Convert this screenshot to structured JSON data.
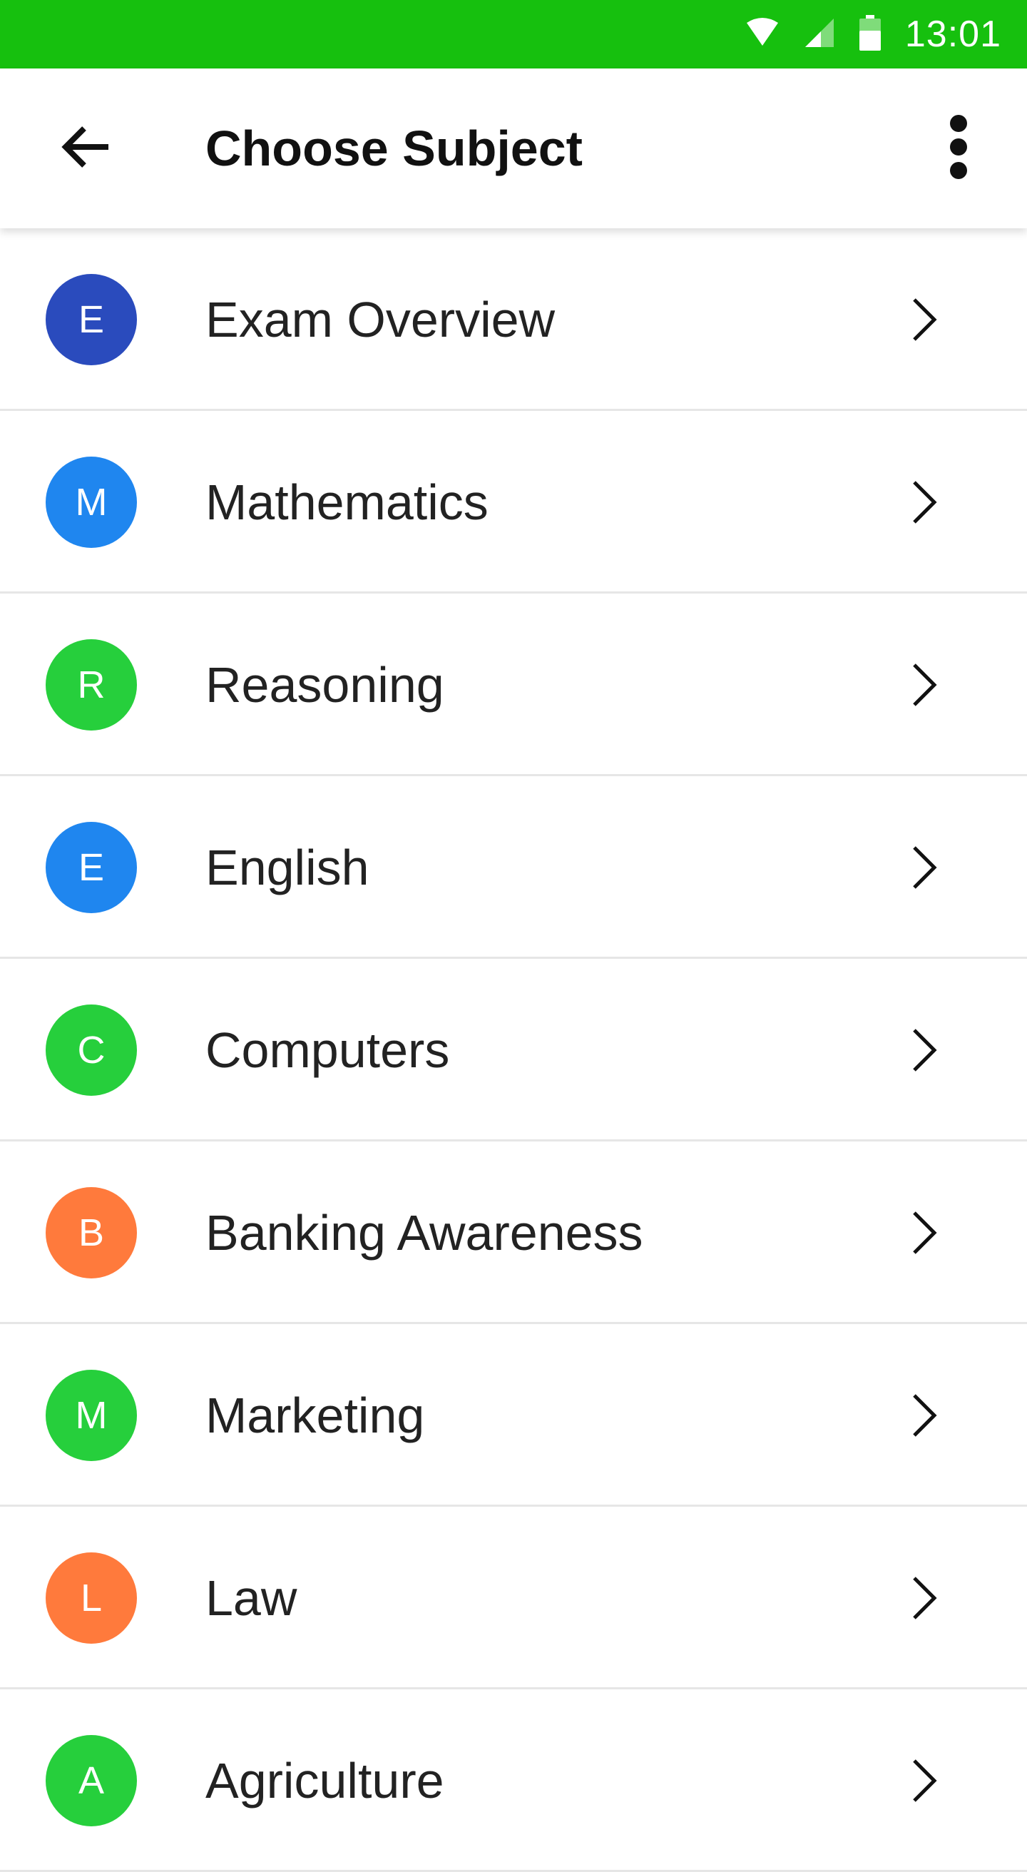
{
  "status_bar": {
    "time": "13:01",
    "icons": [
      "wifi-icon",
      "cell-signal-icon",
      "battery-icon"
    ],
    "background_color": "#16c00e"
  },
  "app_bar": {
    "title": "Choose Subject",
    "back_icon": "arrow-back-icon",
    "menu_icon": "more-vertical-icon"
  },
  "subjects": [
    {
      "initial": "E",
      "label": "Exam Overview",
      "color": "#2a4bbd"
    },
    {
      "initial": "M",
      "label": "Mathematics",
      "color": "#1f86ef"
    },
    {
      "initial": "R",
      "label": "Reasoning",
      "color": "#26cf3c"
    },
    {
      "initial": "E",
      "label": "English",
      "color": "#1f86ef"
    },
    {
      "initial": "C",
      "label": "Computers",
      "color": "#26cf3c"
    },
    {
      "initial": "B",
      "label": "Banking Awareness",
      "color": "#ff7a3c"
    },
    {
      "initial": "M",
      "label": "Marketing",
      "color": "#26cf3c"
    },
    {
      "initial": "L",
      "label": "Law",
      "color": "#ff7a3c"
    },
    {
      "initial": "A",
      "label": "Agriculture",
      "color": "#26cf3c"
    }
  ],
  "chevron_icon": "chevron-right-icon"
}
